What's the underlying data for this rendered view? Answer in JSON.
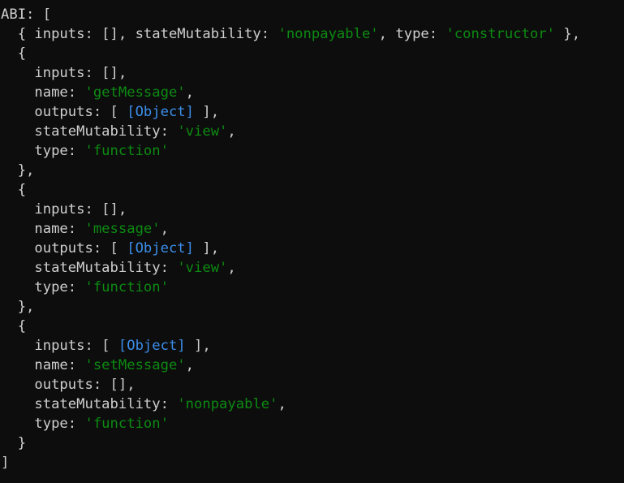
{
  "terminal": {
    "background_color": "#0d0d0d",
    "default_text_color": "#cfcfcf",
    "string_color": "#0d8a12",
    "object_color": "#3b8eea",
    "label": "ABI:",
    "lines": [
      [
        {
          "t": "ABI: [",
          "c": "plain"
        }
      ],
      [
        {
          "t": "  { inputs: [], stateMutability: ",
          "c": "plain"
        },
        {
          "t": "'nonpayable'",
          "c": "string"
        },
        {
          "t": ", type: ",
          "c": "plain"
        },
        {
          "t": "'constructor'",
          "c": "string"
        },
        {
          "t": " },",
          "c": "plain"
        }
      ],
      [
        {
          "t": "  {",
          "c": "plain"
        }
      ],
      [
        {
          "t": "    inputs: [],",
          "c": "plain"
        }
      ],
      [
        {
          "t": "    name: ",
          "c": "plain"
        },
        {
          "t": "'getMessage'",
          "c": "string"
        },
        {
          "t": ",",
          "c": "plain"
        }
      ],
      [
        {
          "t": "    outputs: [ ",
          "c": "plain"
        },
        {
          "t": "[Object]",
          "c": "object"
        },
        {
          "t": " ],",
          "c": "plain"
        }
      ],
      [
        {
          "t": "    stateMutability: ",
          "c": "plain"
        },
        {
          "t": "'view'",
          "c": "string"
        },
        {
          "t": ",",
          "c": "plain"
        }
      ],
      [
        {
          "t": "    type: ",
          "c": "plain"
        },
        {
          "t": "'function'",
          "c": "string"
        }
      ],
      [
        {
          "t": "  },",
          "c": "plain"
        }
      ],
      [
        {
          "t": "  {",
          "c": "plain"
        }
      ],
      [
        {
          "t": "    inputs: [],",
          "c": "plain"
        }
      ],
      [
        {
          "t": "    name: ",
          "c": "plain"
        },
        {
          "t": "'message'",
          "c": "string"
        },
        {
          "t": ",",
          "c": "plain"
        }
      ],
      [
        {
          "t": "    outputs: [ ",
          "c": "plain"
        },
        {
          "t": "[Object]",
          "c": "object"
        },
        {
          "t": " ],",
          "c": "plain"
        }
      ],
      [
        {
          "t": "    stateMutability: ",
          "c": "plain"
        },
        {
          "t": "'view'",
          "c": "string"
        },
        {
          "t": ",",
          "c": "plain"
        }
      ],
      [
        {
          "t": "    type: ",
          "c": "plain"
        },
        {
          "t": "'function'",
          "c": "string"
        }
      ],
      [
        {
          "t": "  },",
          "c": "plain"
        }
      ],
      [
        {
          "t": "  {",
          "c": "plain"
        }
      ],
      [
        {
          "t": "    inputs: [ ",
          "c": "plain"
        },
        {
          "t": "[Object]",
          "c": "object"
        },
        {
          "t": " ],",
          "c": "plain"
        }
      ],
      [
        {
          "t": "    name: ",
          "c": "plain"
        },
        {
          "t": "'setMessage'",
          "c": "string"
        },
        {
          "t": ",",
          "c": "plain"
        }
      ],
      [
        {
          "t": "    outputs: [],",
          "c": "plain"
        }
      ],
      [
        {
          "t": "    stateMutability: ",
          "c": "plain"
        },
        {
          "t": "'nonpayable'",
          "c": "string"
        },
        {
          "t": ",",
          "c": "plain"
        }
      ],
      [
        {
          "t": "    type: ",
          "c": "plain"
        },
        {
          "t": "'function'",
          "c": "string"
        }
      ],
      [
        {
          "t": "  }",
          "c": "plain"
        }
      ],
      [
        {
          "t": "]",
          "c": "plain"
        }
      ]
    ]
  }
}
